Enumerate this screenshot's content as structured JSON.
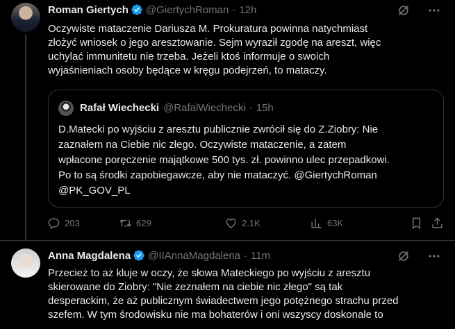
{
  "tweets": [
    {
      "name": "Roman Giertych",
      "handle": "@GiertychRoman",
      "time": "12h",
      "text": "Oczywiste mataczenie Dariusza M. Prokuratura powinna natychmiast\nzłożyć wniosek o jego aresztowanie. Sejm wyraził zgodę na areszt, więc\nuchylać immunitetu nie trzeba. Jeżeli ktoś informuje o swoich\nwyjaśnieniach osoby będące w kręgu podejrzeń, to mataczy.",
      "quote": {
        "name": "Rafał Wiechecki",
        "handle": "@RafalWiechecki",
        "time": "15h",
        "text": "D.Matecki po wyjściu z aresztu publicznie zwrócił się do Z.Ziobry: Nie\nzaznałem na Ciebie nic złego. Oczywiste  mataczenie, a zatem\nwpłacone poręczenie majątkowe 500 tys. zł. powinno ulec przepadkowi.\nPo to są środki zapobiegawcze, aby nie mataczyć.  @GiertychRoman\n@PK_GOV_PL"
      },
      "stats": {
        "replies": "203",
        "retweets": "629",
        "likes": "2.1K",
        "views": "63K"
      }
    },
    {
      "name": "Anna Magdalena",
      "handle": "@IIAnnaMagdalena",
      "time": "11m",
      "text": "Przecież to aż kluje w oczy, że słowa Mateckiego po wyjściu z aresztu\nskierowane do Ziobry: \"Nie zeznałem na ciebie nic złego\" są tak\ndesperackim, że aż publicznym świadectwem jego potężnego strachu przed\nszefem. W tym środowisku nie ma bohaterów i oni wszyscy doskonale to"
    }
  ],
  "colors": {
    "background": "#000000",
    "text": "#e7e9ea",
    "muted": "#71767b",
    "verified": "#1d9bf0",
    "border": "#2f3336"
  },
  "icons": [
    "grok-icon",
    "more-icon",
    "reply-icon",
    "retweet-icon",
    "like-icon",
    "views-icon",
    "bookmark-icon",
    "share-icon",
    "verified-icon"
  ]
}
